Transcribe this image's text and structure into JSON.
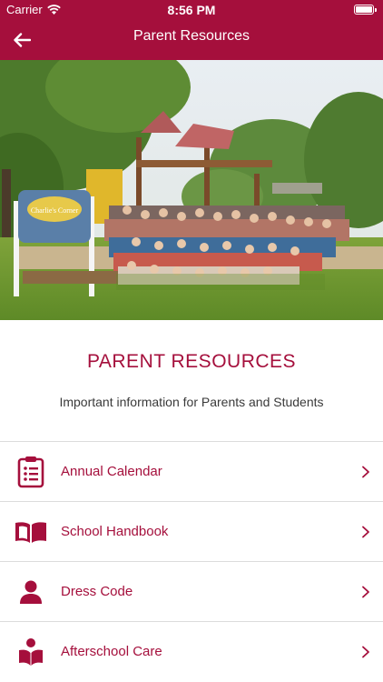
{
  "status": {
    "carrier": "Carrier",
    "time": "8:56 PM"
  },
  "nav": {
    "title": "Parent Resources",
    "back_icon": "arrow-left-icon"
  },
  "hero": {
    "sign_text": "Charlie's Corner"
  },
  "intro": {
    "title": "PARENT RESOURCES",
    "subtitle": "Important information for Parents and Students"
  },
  "colors": {
    "brand": "#a50f3c",
    "text": "#3a3a3a",
    "divider": "#dcdcdc"
  },
  "items": [
    {
      "label": "Annual Calendar",
      "icon": "checklist-icon"
    },
    {
      "label": "School Handbook",
      "icon": "open-book-icon"
    },
    {
      "label": "Dress Code",
      "icon": "person-icon"
    },
    {
      "label": "Afterschool Care",
      "icon": "reading-person-icon"
    }
  ]
}
